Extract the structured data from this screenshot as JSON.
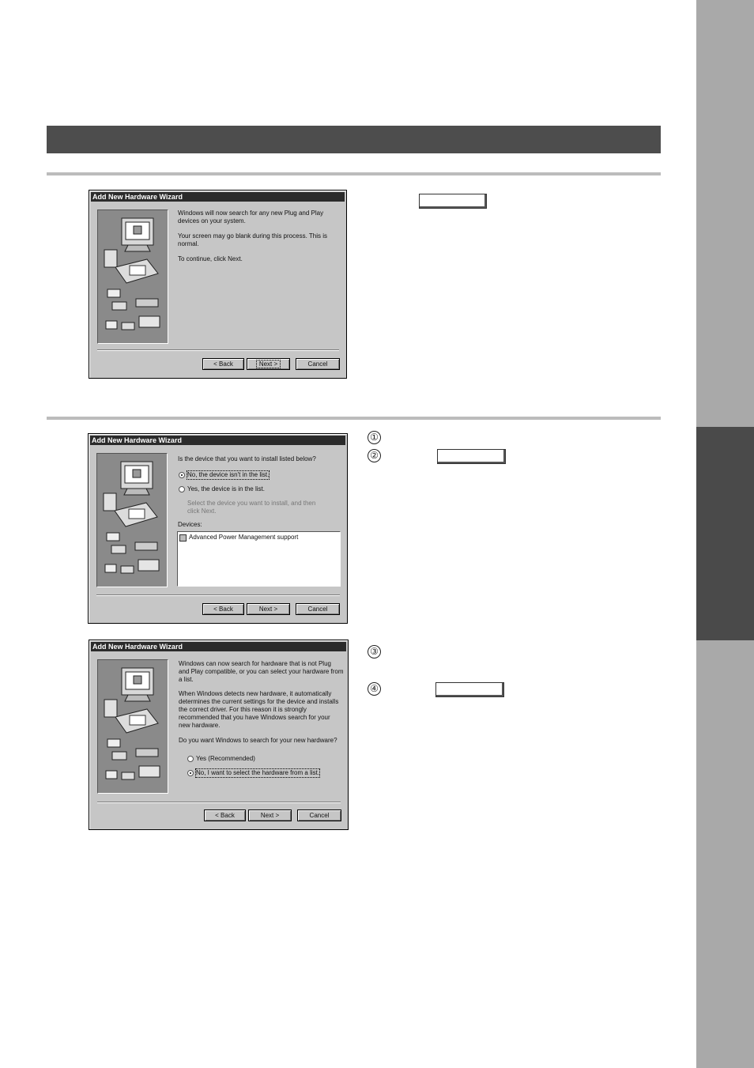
{
  "dialog1": {
    "title": "Add New Hardware Wizard",
    "line1": "Windows will now search for any new Plug and Play",
    "line2": "devices on your system.",
    "line3": "Your screen may go blank during this process. This is",
    "line4": "normal.",
    "line5": "To continue, click Next.",
    "back": "< Back",
    "next": "Next >",
    "cancel": "Cancel"
  },
  "dialog2": {
    "title": "Add New Hardware Wizard",
    "question": "Is the device that you want to install listed below?",
    "option_no": "No, the device isn't in the list.",
    "option_yes": "Yes, the device is in the list.",
    "hint1": "Select the device you want to install, and then",
    "hint2": "click Next.",
    "devices_label": "Devices:",
    "device_item": "Advanced Power Management support",
    "back": "< Back",
    "next": "Next >",
    "cancel": "Cancel"
  },
  "dialog3": {
    "title": "Add New Hardware Wizard",
    "p1_l1": "Windows can now search for hardware that is not Plug",
    "p1_l2": "and Play compatible, or you can select your hardware from",
    "p1_l3": "a list.",
    "p2_l1": "When Windows detects new hardware, it automatically",
    "p2_l2": "determines the current settings for the device and installs",
    "p2_l3": "the correct driver. For this reason it is strongly",
    "p2_l4": "recommended that you have Windows search for your",
    "p2_l5": "new hardware.",
    "question": "Do you want Windows to search for your new hardware?",
    "option_yes": "Yes (Recommended)",
    "option_no": "No, I want to select the hardware from a list.",
    "back": "< Back",
    "next": "Next >",
    "cancel": "Cancel"
  },
  "steps": [
    "①",
    "②",
    "③",
    "④"
  ]
}
